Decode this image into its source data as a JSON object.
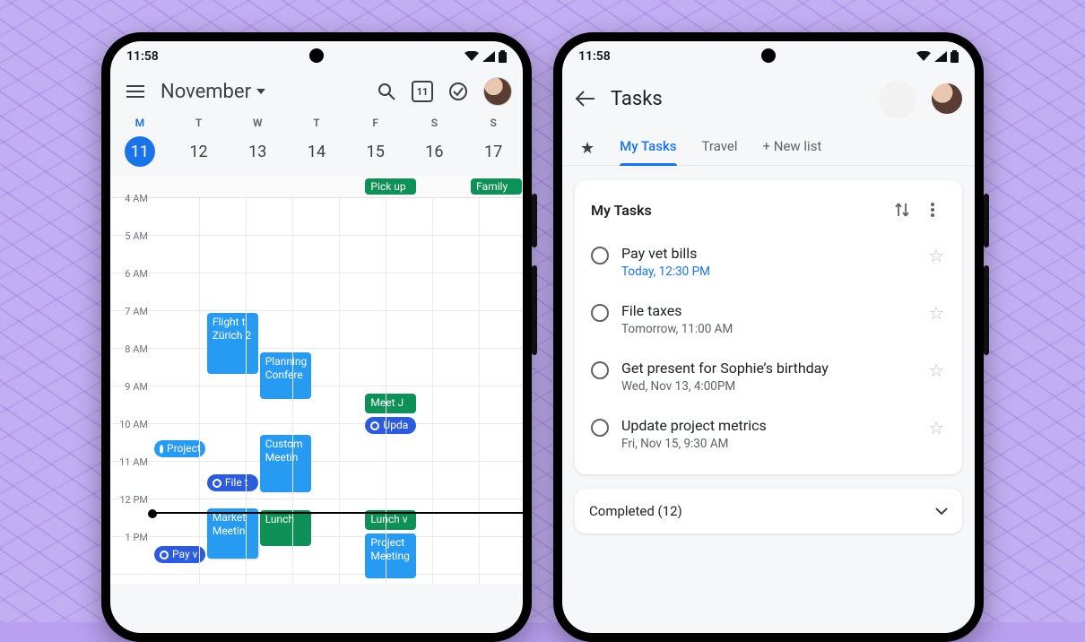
{
  "status": {
    "time": "11:58"
  },
  "calendar": {
    "month_label": "November",
    "today_date_in_icon": "11",
    "dow": [
      "M",
      "T",
      "W",
      "T",
      "F",
      "S",
      "S"
    ],
    "dates": [
      "11",
      "12",
      "13",
      "14",
      "15",
      "16",
      "17"
    ],
    "selected_index": 0,
    "allday": {
      "friday": "Pick up",
      "sunday": "Family"
    },
    "hours": [
      "4 AM",
      "5 AM",
      "6 AM",
      "7 AM",
      "8 AM",
      "9 AM",
      "10 AM",
      "11 AM",
      "12 PM",
      "1 PM"
    ],
    "events": {
      "mon": {
        "project": "Project",
        "pay": "Pay v"
      },
      "tue": {
        "flight": "Flight t\nZürich 2",
        "file": "File t",
        "market": "Market\nMeetin"
      },
      "wed": {
        "planning": "Planning\nConfere",
        "custom": "Custom\nMeetin",
        "lunch": "Lunch"
      },
      "fri": {
        "meet": "Meet J",
        "upda": "Upda",
        "lunch": "Lunch v",
        "project": "Project\nMeeting"
      }
    }
  },
  "tasks": {
    "title": "Tasks",
    "tabs": {
      "my": "My Tasks",
      "travel": "Travel",
      "new": "New list"
    },
    "card_title": "My Tasks",
    "items": [
      {
        "title": "Pay vet bills",
        "sub": "Today, 12:30 PM",
        "subLink": true
      },
      {
        "title": "File taxes",
        "sub": "Tomorrow, 11:00 AM",
        "subLink": false
      },
      {
        "title": "Get present for Sophie’s birthday",
        "sub": "Wed, Nov 13, 4:00PM",
        "subLink": false
      },
      {
        "title": "Update project metrics",
        "sub": "Fri, Nov 15, 9:30 AM",
        "subLink": false
      }
    ],
    "completed_label": "Completed (12)"
  }
}
